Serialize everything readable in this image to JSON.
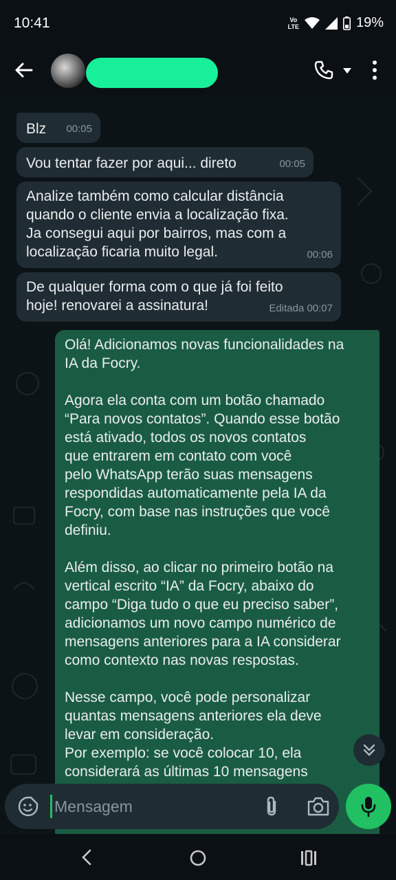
{
  "status": {
    "time": "10:41",
    "battery": "19%",
    "volte_top": "Vo",
    "volte_bottom": "LTE"
  },
  "header": {
    "back": "back-arrow-icon",
    "avatar": "contact-avatar",
    "call": "phone-icon",
    "menu": "more-vert-icon"
  },
  "messages": [
    {
      "dir": "in",
      "text": "Blz",
      "time": "00:05",
      "edited": ""
    },
    {
      "dir": "in",
      "text": "Vou tentar fazer por aqui... direto",
      "time": "00:05",
      "edited": ""
    },
    {
      "dir": "in",
      "text": "Analize também como calcular distância\nquando o cliente envia a localização fixa.\nJa consegui aqui por bairros, mas com a\nlocalização ficaria muito legal.",
      "time": "00:06",
      "edited": ""
    },
    {
      "dir": "in",
      "text": "De qualquer forma com o que já foi feito\nhoje! renovarei a assinatura!",
      "time": "00:07",
      "edited": "Editada"
    },
    {
      "dir": "out",
      "text": "Olá! Adicionamos novas funcionalidades na\nIA da Focry.\n\nAgora ela conta com um botão chamado\n“Para novos contatos”. Quando esse botão\nestá ativado, todos os novos contatos\nque entrarem em contato com você\npelo WhatsApp terão suas mensagens\nrespondidas automaticamente pela IA da\nFocry, com base nas instruções que você\ndefiniu.\n\nAlém disso, ao clicar no primeiro botão na\nvertical escrito “IA” da Focry, abaixo do\ncampo “Diga tudo o que eu preciso saber”,\nadicionamos um novo campo numérico de\nmensagens anteriores para a IA considerar\ncomo contexto nas novas respostas.\n\nNesse campo, você pode personalizar\nquantas mensagens anteriores ela deve\nlevar em consideração.\nPor exemplo: se você colocar 10, ela\nconsiderará as últimas 10 mensagens",
      "time": "",
      "edited": ""
    }
  ],
  "composer": {
    "placeholder": "Mensagem"
  },
  "colors": {
    "accent": "#21c063",
    "incoming": "#202c33",
    "outgoing": "#1a5c43",
    "background": "#0c1317"
  }
}
